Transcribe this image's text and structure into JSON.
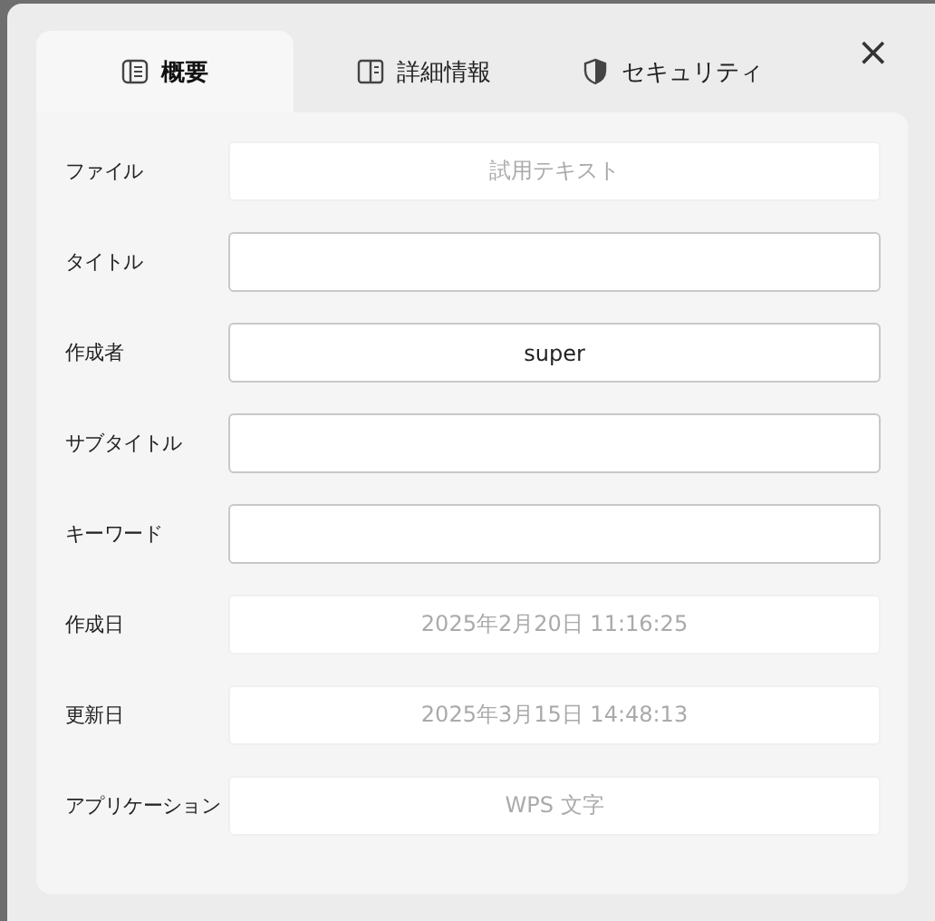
{
  "tabs": [
    {
      "label": "概要",
      "selected": true
    },
    {
      "label": "詳細情報",
      "selected": false
    },
    {
      "label": "セキュリティ",
      "selected": false
    }
  ],
  "close": "×",
  "fields": [
    {
      "label": "ファイル",
      "value": "試用テキスト",
      "disabled": true
    },
    {
      "label": "タイトル",
      "disabled": false
    },
    {
      "label": "作成者",
      "value": "super",
      "disabled": false
    },
    {
      "label": "サブタイトル",
      "disabled": false
    },
    {
      "label": "キーワード",
      "disabled": false
    },
    {
      "label": "作成日",
      "value": "2025年2月20日 11:16:25",
      "disabled": true
    },
    {
      "label": "更新日",
      "value": "2025年3月15日 14:48:13",
      "disabled": true
    },
    {
      "label": "アプリケーション",
      "value": "WPS 文字",
      "disabled": true
    }
  ]
}
